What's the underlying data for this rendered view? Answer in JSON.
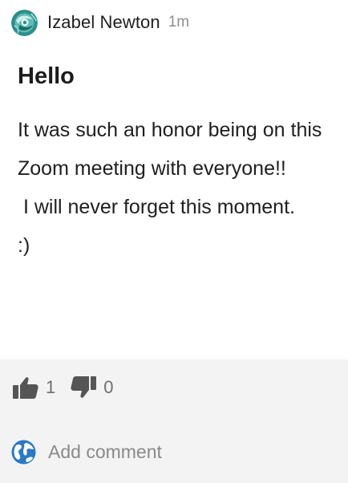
{
  "post": {
    "author": "Izabel Newton",
    "time": "1m",
    "title": "Hello",
    "body": "It was such an honor being on this Zoom meeting with everyone!!\n I will never forget this moment.\n:)"
  },
  "reactions": {
    "likes": "1",
    "dislikes": "0",
    "like_icon": "thumbs-up-icon",
    "dislike_icon": "thumbs-down-icon"
  },
  "comment": {
    "placeholder": "Add comment",
    "icon": "globe-icon"
  },
  "colors": {
    "footer_bg": "#f3f3f3",
    "muted_text": "#8a8a8a",
    "avatar_teal": "#2b8f8c",
    "globe_blue": "#2a78c8"
  }
}
